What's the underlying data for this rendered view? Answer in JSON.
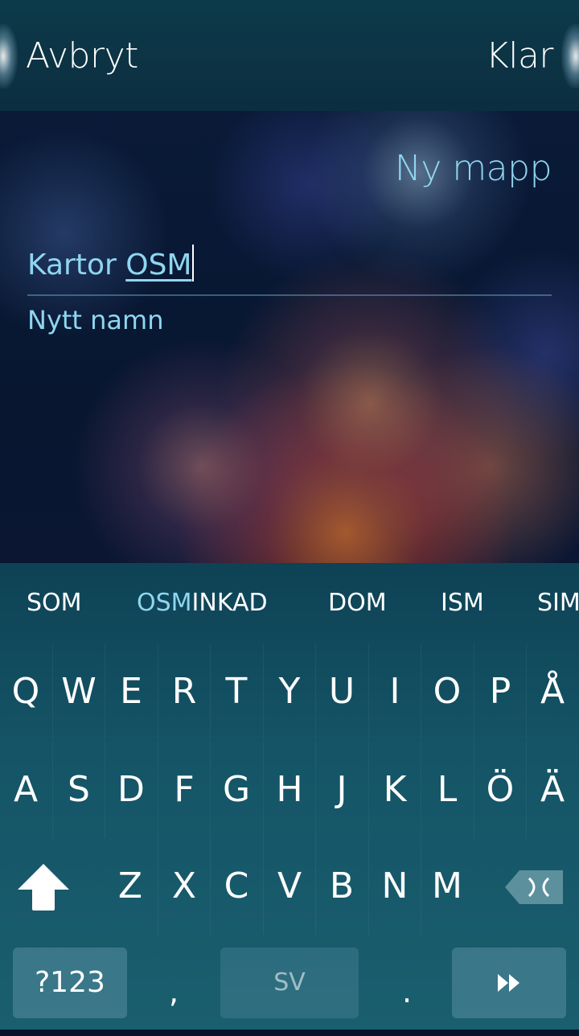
{
  "header": {
    "cancel_label": "Avbryt",
    "accept_label": "Klar"
  },
  "dialog": {
    "title": "Ny mapp",
    "field": {
      "committed_text": "Kartor ",
      "composing_text": "OSM",
      "label": "Nytt namn"
    }
  },
  "keyboard": {
    "predictions": [
      {
        "highlight": "",
        "rest": "SOM"
      },
      {
        "highlight": "OSM",
        "rest": "INKAD"
      },
      {
        "highlight": "",
        "rest": "DOM"
      },
      {
        "highlight": "",
        "rest": "ISM"
      },
      {
        "highlight": "",
        "rest": "SIM"
      }
    ],
    "row1": [
      "Q",
      "W",
      "E",
      "R",
      "T",
      "Y",
      "U",
      "I",
      "O",
      "P",
      "Å"
    ],
    "row2": [
      "A",
      "S",
      "D",
      "F",
      "G",
      "H",
      "J",
      "K",
      "L",
      "Ö",
      "Ä"
    ],
    "row3": [
      "Z",
      "X",
      "C",
      "V",
      "B",
      "N",
      "M"
    ],
    "symbols_label": "?123",
    "comma_label": ",",
    "space_label": "SV",
    "period_label": ".",
    "shift_icon": "shift-arrow-icon",
    "backspace_icon": "backspace-icon",
    "enter_icon": "enter-arrow-icon"
  },
  "colors": {
    "accent": "#8fd6f0",
    "keyboard_bg": "#145466",
    "header_bg": "#0d3a4a"
  }
}
